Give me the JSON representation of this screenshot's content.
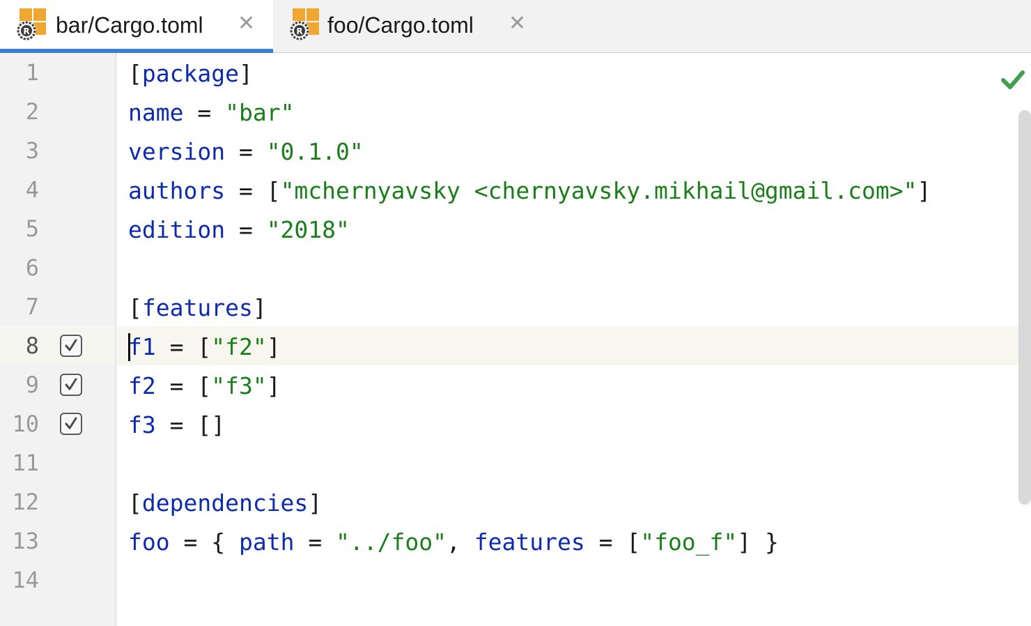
{
  "tabs": [
    {
      "label": "bar/Cargo.toml",
      "icon": "rust-toml-file-icon",
      "active": true
    },
    {
      "label": "foo/Cargo.toml",
      "icon": "rust-toml-file-icon",
      "active": false
    }
  ],
  "close_glyph": "✕",
  "gutter": {
    "line_numbers": [
      "1",
      "2",
      "3",
      "4",
      "5",
      "6",
      "7",
      "8",
      "9",
      "10",
      "11",
      "12",
      "13",
      "14"
    ],
    "current_line": "8",
    "feature_toggles": [
      {
        "line": "8",
        "checked": true
      },
      {
        "line": "9",
        "checked": true
      },
      {
        "line": "10",
        "checked": true
      }
    ]
  },
  "code": {
    "l1": {
      "open": "[",
      "section": "package",
      "close": "]"
    },
    "l2": {
      "key": "name",
      "eq": " = ",
      "value": "\"bar\""
    },
    "l3": {
      "key": "version",
      "eq": " = ",
      "value": "\"0.1.0\""
    },
    "l4": {
      "key": "authors",
      "eq": " = ",
      "open": "[",
      "value": "\"mchernyavsky <chernyavsky.mikhail@gmail.com>\"",
      "close": "]"
    },
    "l5": {
      "key": "edition",
      "eq": " = ",
      "value": "\"2018\""
    },
    "l7": {
      "open": "[",
      "section": "features",
      "close": "]"
    },
    "l8": {
      "key": "f1",
      "eq": " = ",
      "open": "[",
      "value": "\"f2\"",
      "close": "]"
    },
    "l9": {
      "key": "f2",
      "eq": " = ",
      "open": "[",
      "value": "\"f3\"",
      "close": "]"
    },
    "l10": {
      "key": "f3",
      "eq": " = ",
      "value": "[]"
    },
    "l12": {
      "open": "[",
      "section": "dependencies",
      "close": "]"
    },
    "l13": {
      "key": "foo",
      "eq": " = ",
      "brace_open": "{ ",
      "key2": "path",
      "eq2": " = ",
      "value": "\"../foo\"",
      "comma": ", ",
      "key3": "features",
      "eq3": " = ",
      "open": "[",
      "value2": "\"foo_f\"",
      "close": "]",
      "brace_close": " }"
    }
  },
  "status": {
    "inspection": "no-problems-check-icon"
  },
  "colors": {
    "keyword": "#0d2bb0",
    "string": "#1a7f1a",
    "accent": "#3c7ed0",
    "check": "#3f9f4f"
  }
}
